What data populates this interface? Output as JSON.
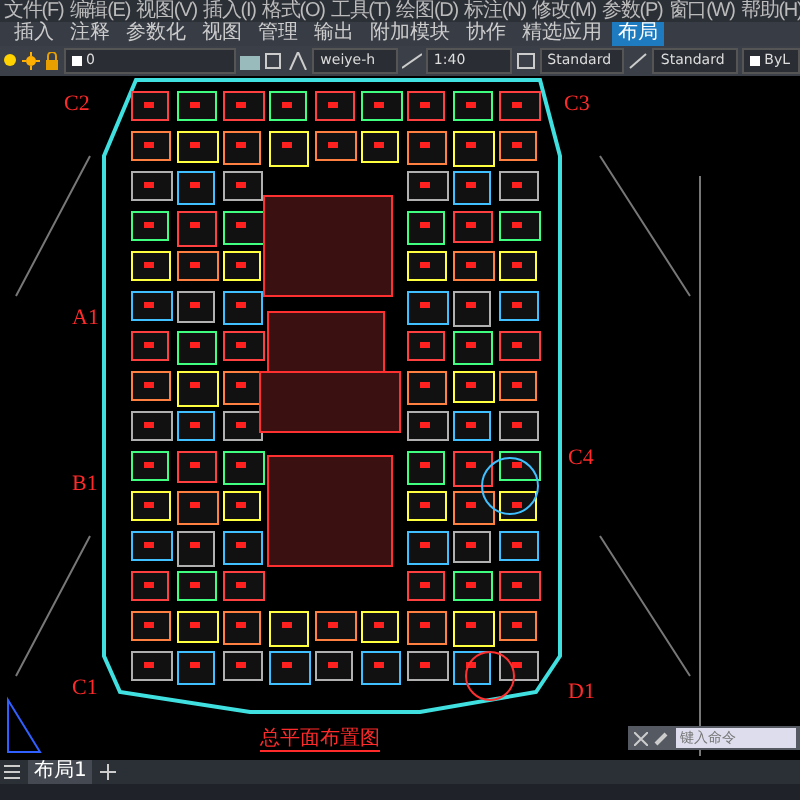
{
  "menu_bar": [
    "文件(F)",
    "编辑(E)",
    "视图(V)",
    "插入(I)",
    "格式(O)",
    "工具(T)",
    "绘图(D)",
    "标注(N)",
    "修改(M)",
    "参数(P)",
    "窗口(W)",
    "帮助(H)"
  ],
  "ribbon_tabs": [
    {
      "label": "插入",
      "selected": false
    },
    {
      "label": "注释",
      "selected": false
    },
    {
      "label": "参数化",
      "selected": false
    },
    {
      "label": "视图",
      "selected": false
    },
    {
      "label": "管理",
      "selected": false
    },
    {
      "label": "输出",
      "selected": false
    },
    {
      "label": "附加模块",
      "selected": false
    },
    {
      "label": "协作",
      "selected": false
    },
    {
      "label": "精选应用",
      "selected": false
    },
    {
      "label": "布局",
      "selected": true
    }
  ],
  "toolbar": {
    "layer": "0",
    "text_style": "weiye-h",
    "scale": "1:40",
    "dim_style": "Standard",
    "table_style": "Standard",
    "lineweight": "ByL"
  },
  "drawing": {
    "zone_labels": [
      "C2",
      "C3",
      "A1",
      "C4",
      "B1",
      "C1",
      "D1"
    ],
    "title": "总平面布置图"
  },
  "layout_tabs": [
    {
      "label": "布局1",
      "selected": true
    }
  ],
  "command_line": {
    "placeholder": "键入命令"
  }
}
